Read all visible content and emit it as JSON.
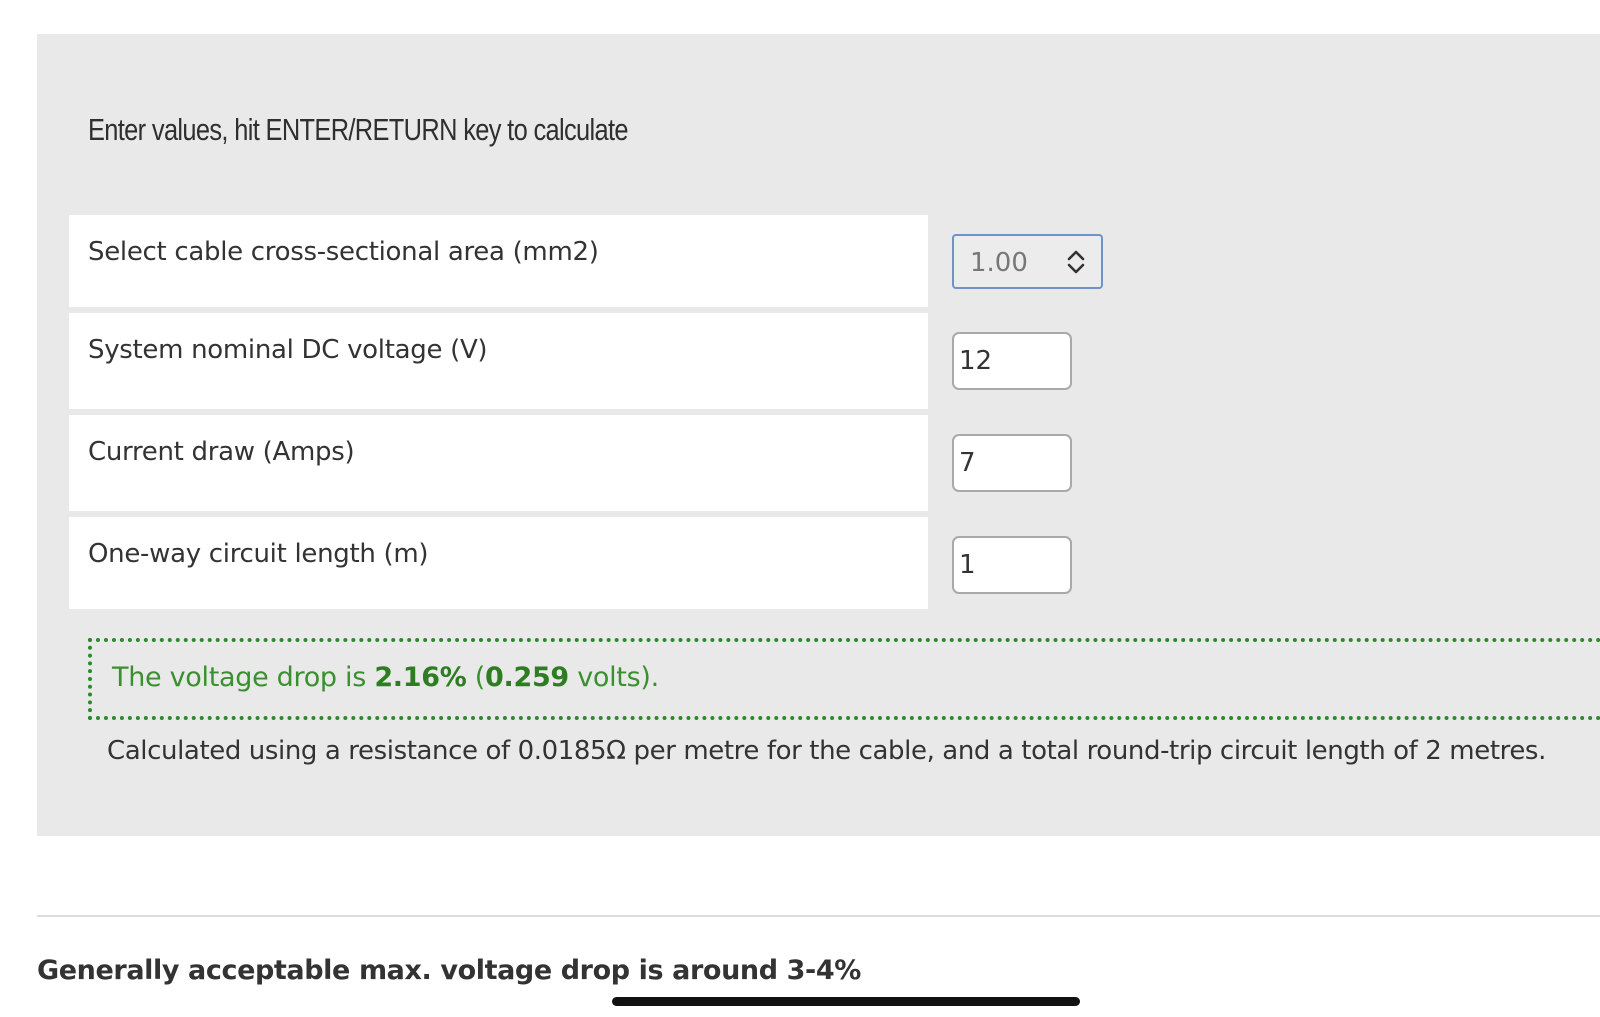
{
  "instructions": "Enter values, hit ENTER/RETURN key to calculate",
  "fields": {
    "cable_area": {
      "label": "Select cable cross-sectional area (mm2)",
      "selected": "1.00"
    },
    "voltage": {
      "label": "System nominal DC voltage (V)",
      "value": "12"
    },
    "current": {
      "label": "Current draw (Amps)",
      "value": "7"
    },
    "length": {
      "label": "One-way circuit length (m)",
      "value": "1"
    }
  },
  "result": {
    "prefix": "The voltage drop is ",
    "percent": "2.16%",
    "middle": " (",
    "volts": "0.259",
    "suffix": " volts)."
  },
  "note": "Calculated using a resistance of 0.0185Ω per metre for the cable, and a total round-trip circuit length of 2 metres.",
  "footer_note": "Generally acceptable max. voltage drop is around 3-4%",
  "icons": {
    "select_arrows": "chevron-up-down-icon"
  },
  "colors": {
    "panel_bg": "#e9e9e9",
    "result_green": "#3a8f2e",
    "select_border": "#6f93c6"
  }
}
